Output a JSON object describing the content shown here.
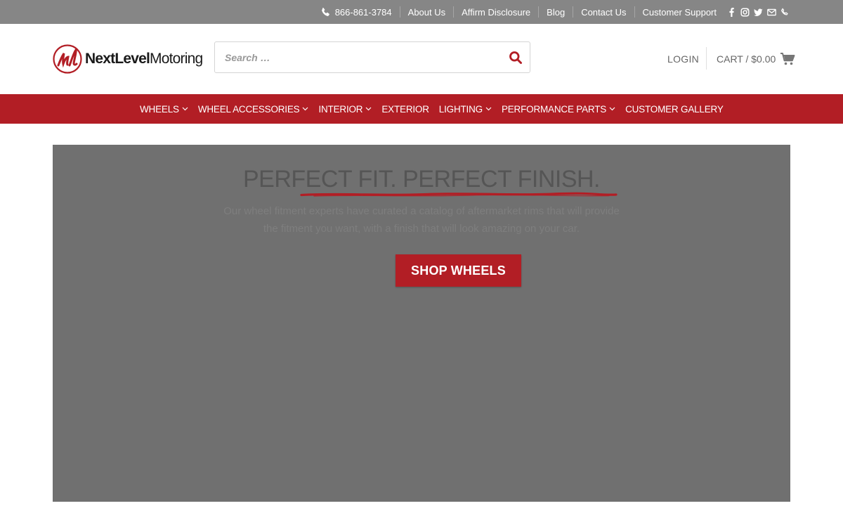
{
  "topbar": {
    "phone": "866-861-3784",
    "links": [
      "About Us",
      "Affirm Disclosure",
      "Blog",
      "Contact Us",
      "Customer Support"
    ],
    "social_icons": [
      "facebook-icon",
      "instagram-icon",
      "twitter-icon",
      "email-icon",
      "phone-icon"
    ]
  },
  "header": {
    "logo": {
      "bold": "NextLevel",
      "regular": "Motoring"
    },
    "search_placeholder": "Search …",
    "login": "LOGIN",
    "cart": "CART / $0.00"
  },
  "nav": {
    "items": [
      {
        "label": "WHEELS",
        "has_dropdown": true
      },
      {
        "label": "WHEEL ACCESSORIES",
        "has_dropdown": true
      },
      {
        "label": "INTERIOR",
        "has_dropdown": true
      },
      {
        "label": "EXTERIOR",
        "has_dropdown": false
      },
      {
        "label": "LIGHTING",
        "has_dropdown": true
      },
      {
        "label": "PERFORMANCE PARTS",
        "has_dropdown": true
      },
      {
        "label": "CUSTOMER GALLERY",
        "has_dropdown": false
      }
    ]
  },
  "hero": {
    "title": "PERFECT FIT. PERFECT FINISH.",
    "description": "Our wheel fitment experts have curated a catalog of aftermarket rims that will provide the fitment you want, with a finish that will look amazing on your car.",
    "cta": "SHOP WHEELS"
  },
  "colors": {
    "brand_red": "#b21e25",
    "topbar_gray": "#868686",
    "hero_overlay": "#707070"
  }
}
